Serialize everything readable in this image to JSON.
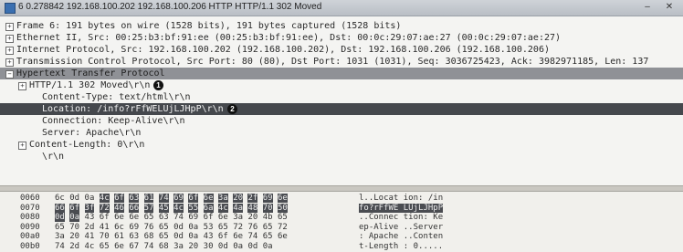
{
  "window": {
    "title": "6 0.278842 192.168.100.202 192.168.100.206 HTTP HTTP/1.1 302 Moved",
    "minimize_label": "–",
    "close_label": "✕"
  },
  "tree": {
    "rows": [
      {
        "text": "Frame 6: 191 bytes on wire (1528 bits), 191 bytes captured (1528 bits)",
        "expander": "+",
        "indent": 0,
        "style": "normal"
      },
      {
        "text": "Ethernet II, Src: 00:25:b3:bf:91:ee (00:25:b3:bf:91:ee), Dst: 00:0c:29:07:ae:27 (00:0c:29:07:ae:27)",
        "expander": "+",
        "indent": 0,
        "style": "normal"
      },
      {
        "text": "Internet Protocol, Src: 192.168.100.202 (192.168.100.202), Dst: 192.168.100.206 (192.168.100.206)",
        "expander": "+",
        "indent": 0,
        "style": "normal"
      },
      {
        "text": "Transmission Control Protocol, Src Port: 80 (80), Dst Port: 1031 (1031), Seq: 3036725423, Ack: 3982971185, Len: 137",
        "expander": "+",
        "indent": 0,
        "style": "normal"
      },
      {
        "text": "Hypertext Transfer Protocol",
        "expander": "−",
        "indent": 0,
        "style": "gray"
      },
      {
        "text": "HTTP/1.1 302 Moved\\r\\n",
        "expander": "+",
        "indent": 1,
        "style": "normal",
        "badge": "1"
      },
      {
        "text": "Content-Type: text/html\\r\\n",
        "expander": "",
        "indent": 2,
        "style": "normal"
      },
      {
        "text": "Location: /info?rFfWELUjLJHpP\\r\\n",
        "expander": "",
        "indent": 2,
        "style": "sel",
        "badge": "2"
      },
      {
        "text": "Connection: Keep-Alive\\r\\n",
        "expander": "",
        "indent": 2,
        "style": "normal"
      },
      {
        "text": "Server: Apache\\r\\n",
        "expander": "",
        "indent": 2,
        "style": "normal"
      },
      {
        "text": "Content-Length: 0\\r\\n",
        "expander": "+",
        "indent": 1,
        "style": "normal"
      },
      {
        "text": "\\r\\n",
        "expander": "",
        "indent": 2,
        "style": "normal"
      }
    ]
  },
  "hex": {
    "rows": [
      {
        "offset": "0060",
        "bytes": "6c 0d 0a 4c 6f 63 61 74  69 6f 6e 3a 20 2f 69 6e",
        "ascii": "l..Locat ion: /in",
        "hl_from": 3
      },
      {
        "offset": "0070",
        "bytes": "66 6f 3f 72 46 66 57 45  4c 55 6a 4c 4a 48 70 50",
        "ascii": "fo?rFfWE LUjLJHpP",
        "hl_all": true
      },
      {
        "offset": "0080",
        "bytes": "0d 0a 43 6f 6e 6e 65 63  74 69 6f 6e 3a 20 4b 65",
        "ascii": "..Connec tion: Ke",
        "hl_to": 2
      },
      {
        "offset": "0090",
        "bytes": "65 70 2d 41 6c 69 76 65  0d 0a 53 65 72 76 65 72",
        "ascii": "ep-Alive ..Server"
      },
      {
        "offset": "00a0",
        "bytes": "3a 20 41 70 61 63 68 65  0d 0a 43 6f 6e 74 65 6e",
        "ascii": ": Apache ..Conten"
      },
      {
        "offset": "00b0",
        "bytes": "74 2d 4c 65 6e 67 74 68  3a 20 30 0d 0a 0d 0a",
        "ascii": "t-Length : 0....."
      }
    ]
  }
}
